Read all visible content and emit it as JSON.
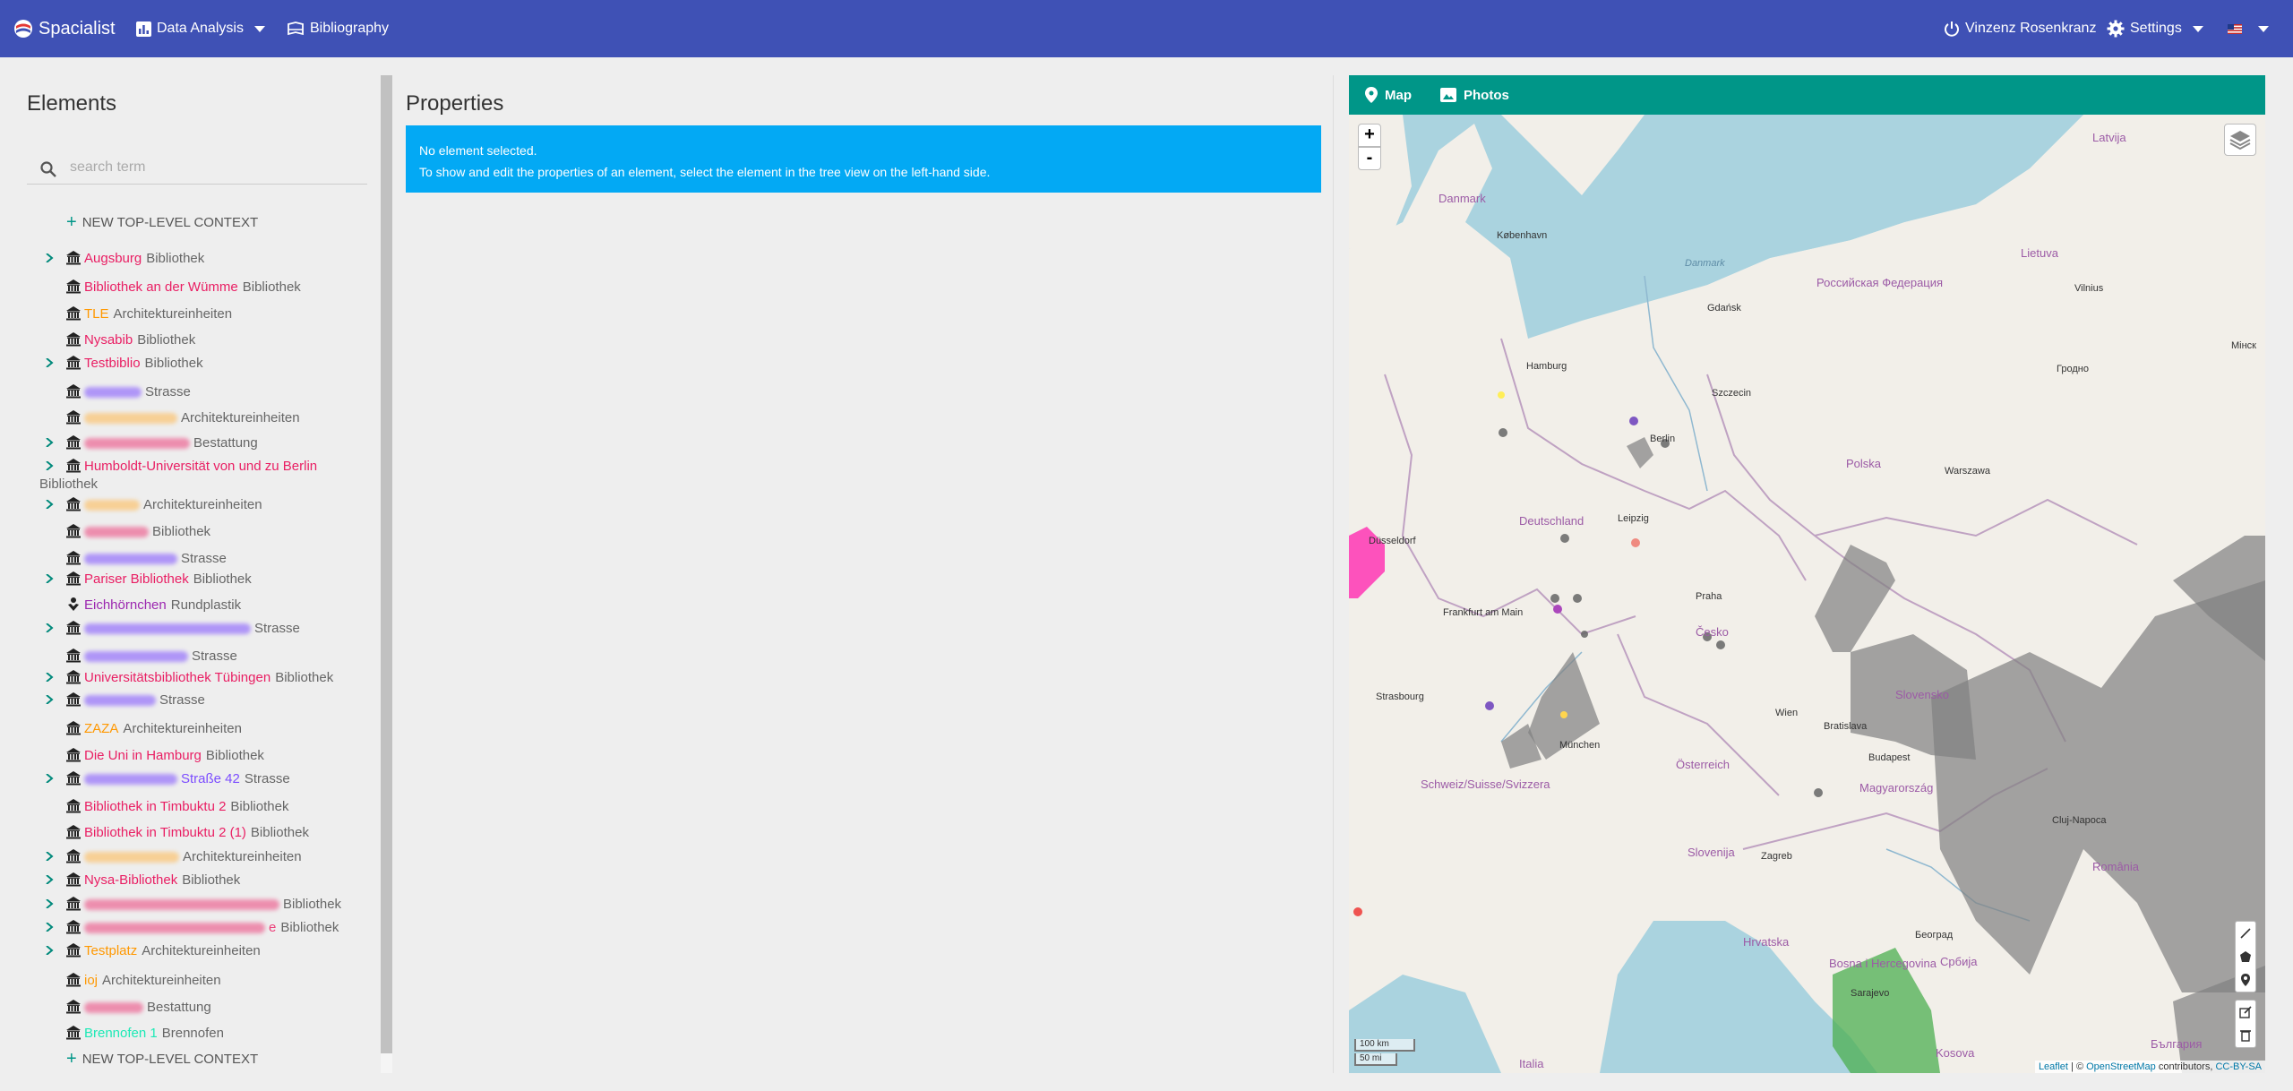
{
  "navbar": {
    "brand": "Spacialist",
    "data_analysis": "Data Analysis",
    "bibliography": "Bibliography",
    "user": "Vinzenz Rosenkranz",
    "settings": "Settings",
    "bg_color": "#3f51b5"
  },
  "elements_panel": {
    "title": "Elements",
    "search_placeholder": "search term",
    "new_context_label": "NEW TOP-LEVEL CONTEXT",
    "tree": [
      {
        "name": "Augsburg",
        "type": "Bibliothek",
        "color": "#e91e63",
        "expandable": true,
        "icon": "museum-icon"
      },
      {
        "name": "Bibliothek an der Wümme",
        "type": "Bibliothek",
        "color": "#e91e63",
        "expandable": false,
        "icon": "museum-icon"
      },
      {
        "name": "TLE",
        "type": "Architektureinheiten",
        "color": "#ff9800",
        "expandable": false,
        "icon": "museum-icon"
      },
      {
        "name": "Nysabib",
        "type": "Bibliothek",
        "color": "#e91e63",
        "expandable": false,
        "icon": "museum-icon"
      },
      {
        "name": "Testbiblio",
        "type": "Bibliothek",
        "color": "#e91e63",
        "expandable": true,
        "icon": "museum-icon"
      },
      {
        "name": "",
        "type": "Strasse",
        "color": "#7c4dff",
        "expandable": false,
        "icon": "museum-icon",
        "redacted": 64
      },
      {
        "name": "",
        "type": "Architektureinheiten",
        "color": "#ffb74d",
        "expandable": false,
        "icon": "museum-icon",
        "redacted": 104
      },
      {
        "name": "",
        "type": "Bestattung",
        "color": "#ec407a",
        "expandable": true,
        "icon": "museum-icon",
        "redacted": 118
      },
      {
        "name": "Humboldt-Universität von und zu Berlin",
        "type": "Bibliothek",
        "color": "#e91e63",
        "expandable": true,
        "icon": "museum-icon",
        "wrap": true
      },
      {
        "name": "",
        "type": "Architektureinheiten",
        "color": "#ffb74d",
        "expandable": true,
        "icon": "museum-icon",
        "redacted": 62
      },
      {
        "name": "",
        "type": "Bibliothek",
        "color": "#ec407a",
        "expandable": false,
        "icon": "museum-icon",
        "redacted": 72
      },
      {
        "name": "",
        "type": "Strasse",
        "color": "#7c4dff",
        "expandable": false,
        "icon": "museum-icon",
        "redacted": 104
      },
      {
        "name": "Pariser Bibliothek",
        "type": "Bibliothek",
        "color": "#e91e63",
        "expandable": true,
        "icon": "museum-icon"
      },
      {
        "name": "Eichhörnchen",
        "type": "Rundplastik",
        "color": "#9c27b0",
        "expandable": false,
        "icon": "sculpture-icon"
      },
      {
        "name": "",
        "type": "Strasse",
        "color": "#7c4dff",
        "expandable": true,
        "icon": "museum-icon",
        "redacted": 186
      },
      {
        "name": "",
        "type": "Strasse",
        "color": "#7c4dff",
        "expandable": false,
        "icon": "museum-icon",
        "redacted": 116
      },
      {
        "name": "Universitätsbibliothek Tübingen",
        "type": "Bibliothek",
        "color": "#e91e63",
        "expandable": true,
        "icon": "museum-icon"
      },
      {
        "name": "",
        "type": "Strasse",
        "color": "#7c4dff",
        "expandable": true,
        "icon": "museum-icon",
        "redacted": 80
      },
      {
        "name": "ZAZA",
        "type": "Architektureinheiten",
        "color": "#ff9800",
        "expandable": false,
        "icon": "museum-icon"
      },
      {
        "name": "Die Uni in Hamburg",
        "type": "Bibliothek",
        "color": "#e91e63",
        "expandable": false,
        "icon": "museum-icon"
      },
      {
        "name": "Straße 42",
        "type": "Strasse",
        "color": "#7c4dff",
        "expandable": true,
        "icon": "museum-icon",
        "redacted": 104
      },
      {
        "name": "Bibliothek in Timbuktu 2",
        "type": "Bibliothek",
        "color": "#e91e63",
        "expandable": false,
        "icon": "museum-icon"
      },
      {
        "name": "Bibliothek in Timbuktu 2 (1)",
        "type": "Bibliothek",
        "color": "#e91e63",
        "expandable": false,
        "icon": "museum-icon"
      },
      {
        "name": "",
        "type": "Architektureinheiten",
        "color": "#ffb74d",
        "expandable": true,
        "icon": "museum-icon",
        "redacted": 106
      },
      {
        "name": "Nysa-Bibliothek",
        "type": "Bibliothek",
        "color": "#e91e63",
        "expandable": true,
        "icon": "museum-icon"
      },
      {
        "name": "",
        "type": "Bibliothek",
        "color": "#ec407a",
        "expandable": true,
        "icon": "museum-icon",
        "redacted": 218
      },
      {
        "name": "e",
        "type": "Bibliothek",
        "color": "#ec407a",
        "expandable": true,
        "icon": "museum-icon",
        "redacted": 202
      },
      {
        "name": "Testplatz",
        "type": "Architektureinheiten",
        "color": "#ff9800",
        "expandable": true,
        "icon": "museum-icon"
      },
      {
        "name": "ioj",
        "type": "Architektureinheiten",
        "color": "#ff9800",
        "expandable": false,
        "icon": "museum-icon"
      },
      {
        "name": "",
        "type": "Bestattung",
        "color": "#ec407a",
        "expandable": false,
        "icon": "museum-icon",
        "redacted": 66
      },
      {
        "name": "Brennofen 1",
        "type": "Brennofen",
        "color": "#1de9b6",
        "expandable": false,
        "icon": "museum-icon"
      }
    ]
  },
  "properties_panel": {
    "title": "Properties",
    "alert_line1": "No element selected.",
    "alert_line2": "To show and edit the properties of an element, select the element in the tree view on the left-hand side.",
    "alert_color": "#03a9f4"
  },
  "map_panel": {
    "tabs": [
      "Map",
      "Photos"
    ],
    "tab_bar_color": "#009688",
    "zoom_in": "+",
    "zoom_out": "-",
    "scale_km": "100 km",
    "scale_mi": "50 mi",
    "attribution_leaflet": "Leaflet",
    "attribution_sep": "| ©",
    "attribution_osm": "OpenStreetMap",
    "attribution_contrib": "contributors,",
    "attribution_license": "CC-BY-SA",
    "labels": {
      "danmark": "Danmark",
      "kobenhavn": "København",
      "hamburg": "Hamburg",
      "berlin": "Berlin",
      "deutschland": "Deutschland",
      "polska": "Polska",
      "warszawa": "Warszawa",
      "praha": "Praha",
      "cesko": "Česko",
      "wien": "Wien",
      "osterreich": "Österreich",
      "munchen": "München",
      "frankfurt": "Frankfurt am Main",
      "slovensko": "Slovensko",
      "budapest": "Budapest",
      "magyarorszag": "Magyarország",
      "romania": "România",
      "schweiz": "Schweiz/Suisse/Svizzera",
      "slovenija": "Slovenija",
      "hrvatska": "Hrvatska",
      "bosna": "Bosna i Hercegovina",
      "srbija": "Србија",
      "italia": "Italia",
      "lietuva": "Lietuva",
      "latvija": "Latvija",
      "vilnius": "Vilnius",
      "gdansk": "Gdańsk",
      "szczecin": "Szczecin",
      "leipzig": "Leipzig",
      "dusseldorf": "Düsseldorf",
      "strasbourg": "Strasbourg",
      "zagreb": "Zagreb",
      "beograd": "Београд",
      "sarajevo": "Sarajevo",
      "bratislava": "Bratislava",
      "cluj": "Cluj-Napoca",
      "kosova": "Kosova",
      "bulgaria": "България",
      "rossiya": "Российская Федерация",
      "minsk": "Мінск",
      "grodno": "Гродно"
    }
  }
}
